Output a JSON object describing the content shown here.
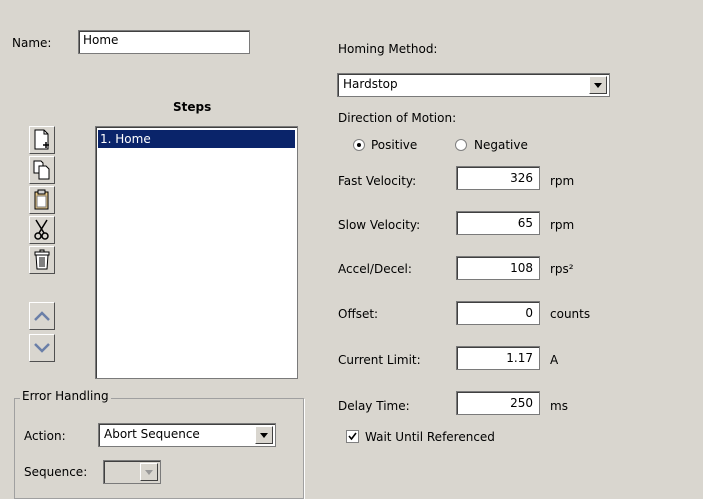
{
  "name_field": {
    "label": "Name:",
    "value": "Home"
  },
  "steps": {
    "title": "Steps",
    "items": [
      "1. Home"
    ],
    "toolbar": [
      "new-step",
      "copy-step",
      "paste-step",
      "cut-step",
      "delete-step",
      "move-up",
      "move-down"
    ]
  },
  "error_handling": {
    "title": "Error Handling",
    "action_label": "Action:",
    "action_value": "Abort Sequence",
    "sequence_label": "Sequence:",
    "sequence_value": ""
  },
  "homing": {
    "method_label": "Homing Method:",
    "method_value": "Hardstop",
    "direction_label": "Direction of Motion:",
    "direction_options": [
      "Positive",
      "Negative"
    ],
    "direction_selected": "Positive",
    "params": [
      {
        "label": "Fast Velocity:",
        "value": "326",
        "unit": "rpm"
      },
      {
        "label": "Slow Velocity:",
        "value": "65",
        "unit": "rpm"
      },
      {
        "label": "Accel/Decel:",
        "value": "108",
        "unit": "rps²"
      },
      {
        "label": "Offset:",
        "value": "0",
        "unit": "counts"
      },
      {
        "label": "Current Limit:",
        "value": "1.17",
        "unit": "A"
      },
      {
        "label": "Delay Time:",
        "value": "250",
        "unit": "ms"
      }
    ],
    "wait_label": "Wait Until Referenced",
    "wait_checked": true
  },
  "colors": {
    "background": "#d9d6cf",
    "selection": "#0a246a"
  }
}
